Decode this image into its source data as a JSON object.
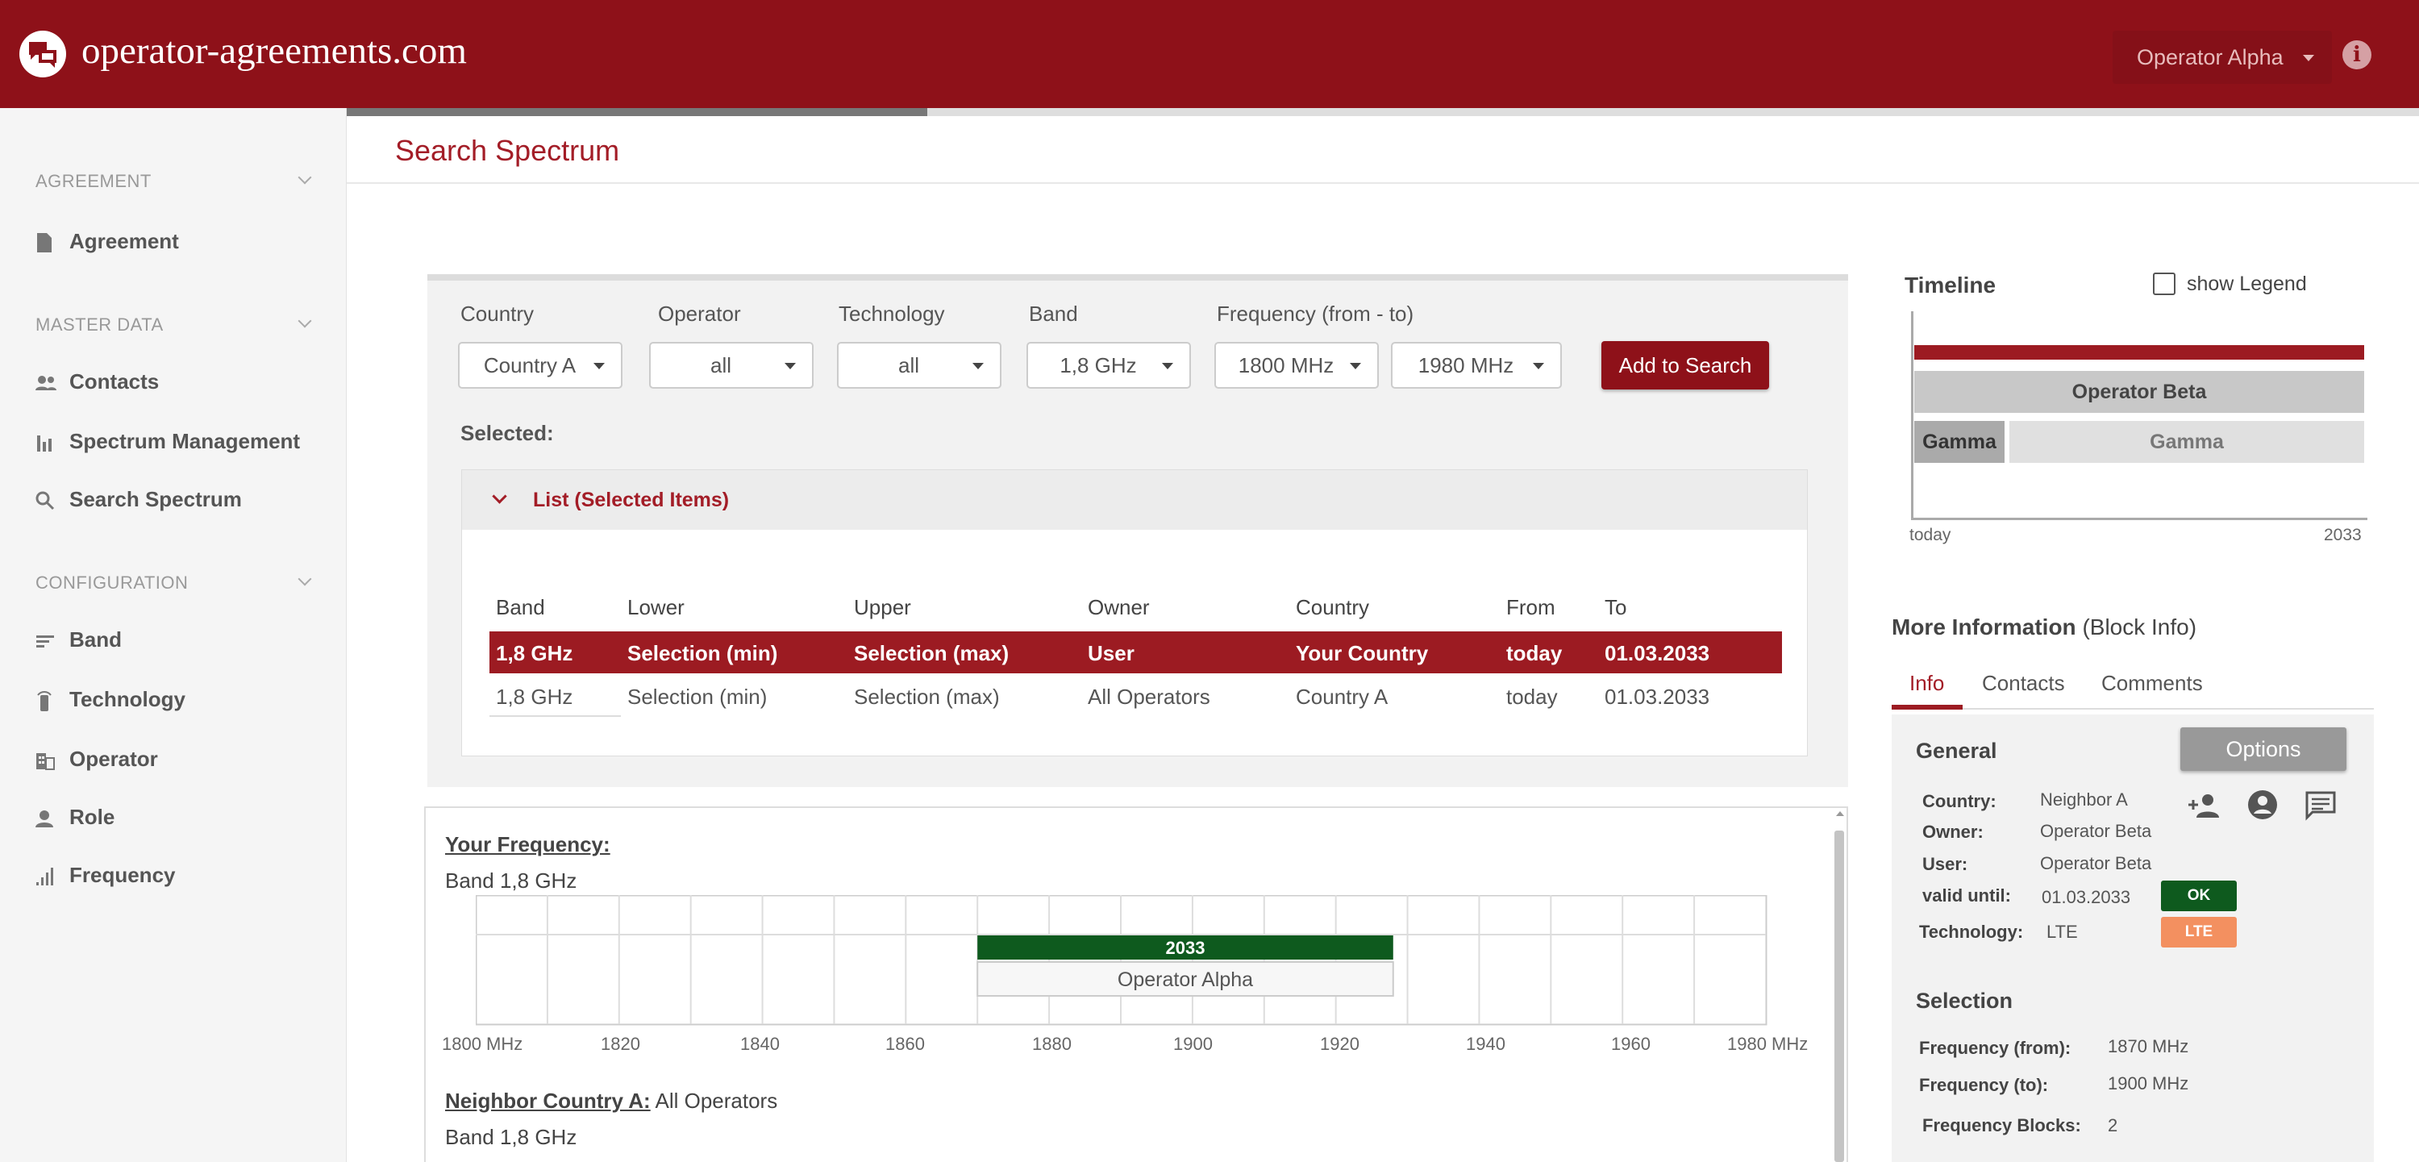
{
  "header": {
    "site": "operator-agreements.com",
    "operator": "Operator Alpha"
  },
  "sidebar": {
    "sections": [
      {
        "label": "AGREEMENT"
      },
      {
        "label": "MASTER DATA"
      },
      {
        "label": "CONFIGURATION"
      }
    ],
    "items": [
      {
        "label": "Agreement",
        "icon": "document-icon"
      },
      {
        "label": "Contacts",
        "icon": "people-icon"
      },
      {
        "label": "Spectrum Management",
        "icon": "bar-chart-icon"
      },
      {
        "label": "Search Spectrum",
        "icon": "search-icon"
      },
      {
        "label": "Band",
        "icon": "lines-icon"
      },
      {
        "label": "Technology",
        "icon": "antenna-icon"
      },
      {
        "label": "Operator",
        "icon": "building-icon"
      },
      {
        "label": "Role",
        "icon": "person-icon"
      },
      {
        "label": "Frequency",
        "icon": "signal-icon"
      }
    ]
  },
  "page": {
    "title": "Search Spectrum",
    "progress": 0.28
  },
  "search": {
    "labels": {
      "country": "Country",
      "operator": "Operator",
      "technology": "Technology",
      "band": "Band",
      "frequency": "Frequency (from - to)"
    },
    "values": {
      "country": "Country A",
      "operator": "all",
      "technology": "all",
      "band": "1,8 GHz",
      "freq_from": "1800 MHz",
      "freq_to": "1980 MHz"
    },
    "add_button": "Add to Search",
    "selected_label": "Selected:",
    "list_title": "List (Selected Items)",
    "columns": [
      "Band",
      "Lower",
      "Upper",
      "Owner",
      "Country",
      "From",
      "To"
    ],
    "rows": [
      [
        "1,8 GHz",
        "Selection (min)",
        "Selection (max)",
        "User",
        "Your Country",
        "today",
        "01.03.2033"
      ],
      [
        "1,8 GHz",
        "Selection (min)",
        "Selection (max)",
        "All Operators",
        "Country A",
        "today",
        "01.03.2033"
      ]
    ]
  },
  "frequency": {
    "your_label": "Your Frequency:",
    "band_label": "Band 1,8 GHz",
    "neighbor_label": "Neighbor Country A:",
    "neighbor_value": "All Operators",
    "neighbor_band": "Band 1,8 GHz"
  },
  "chart_data": {
    "type": "bar",
    "x_ticks": [
      "1800 MHz",
      "1820",
      "1840",
      "1860",
      "1880",
      "1900",
      "1920",
      "1940",
      "1960",
      "1980 MHz"
    ],
    "xlim": [
      1800,
      1980
    ],
    "grid": true,
    "bars": [
      {
        "label": "2033",
        "from": 1870,
        "to": 1928,
        "color": "#0e5a1e"
      }
    ],
    "blocks": [
      {
        "label": "Operator Alpha",
        "from": 1870,
        "to": 1928
      }
    ]
  },
  "timeline": {
    "title": "Timeline",
    "legend_label": "show Legend",
    "start": "today",
    "end": "2033",
    "bars": [
      "Operator Beta",
      "Gamma",
      "Gamma"
    ]
  },
  "info": {
    "title": "More Information",
    "subtitle": "(Block Info)",
    "tabs": [
      "Info",
      "Contacts",
      "Comments"
    ],
    "general": "General",
    "options": "Options",
    "fields": [
      {
        "key": "Country:",
        "value": "Neighbor A"
      },
      {
        "key": "Owner:",
        "value": "Operator Beta"
      },
      {
        "key": "User:",
        "value": "Operator Beta"
      },
      {
        "key": "valid until:",
        "value": "01.03.2033"
      },
      {
        "key": "Technology:",
        "value": "LTE"
      }
    ],
    "status": "OK",
    "tech_badge": "LTE",
    "selection": "Selection",
    "sel_fields": [
      {
        "key": "Frequency (from):",
        "value": "1870 MHz"
      },
      {
        "key": "Frequency (to):",
        "value": "1900 MHz"
      },
      {
        "key": "Frequency Blocks:",
        "value": "2"
      }
    ],
    "colors": {
      "accent": "#8e1119",
      "ok": "#0e5a1e",
      "lte": "#f39060"
    }
  }
}
